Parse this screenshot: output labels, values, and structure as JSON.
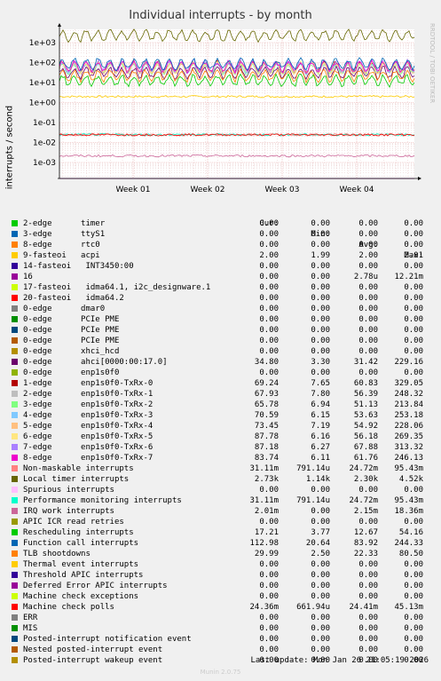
{
  "chart_data": {
    "type": "line",
    "title": "Individual interrupts - by month",
    "ylabel": "interrupts / second",
    "y_scale": "log",
    "ylim": [
      0.0001,
      3000
    ],
    "y_ticks": [
      "1e+03",
      "1e+02",
      "1e+01",
      "1e+00",
      "1e-01",
      "1e-02",
      "1e-03"
    ],
    "x_ticks": [
      "Week 01",
      "Week 02",
      "Week 03",
      "Week 04"
    ],
    "grid": true,
    "watermark": "RRDTOOL / TOBI OETIKER",
    "columns": [
      "Cur:",
      "Min:",
      "Avg:",
      "Max:"
    ],
    "series": [
      {
        "name": "2-edge      timer",
        "color": "#00cc00",
        "cur": "0.00",
        "min": "0.00",
        "avg": "0.00",
        "max": "0.00"
      },
      {
        "name": "3-edge      ttyS1",
        "color": "#0066b3",
        "cur": "0.00",
        "min": "0.00",
        "avg": "0.00",
        "max": "0.00"
      },
      {
        "name": "8-edge      rtc0",
        "color": "#ff8000",
        "cur": "0.00",
        "min": "0.00",
        "avg": "0.00",
        "max": "0.00"
      },
      {
        "name": "9-fasteoi   acpi",
        "color": "#ffcc00",
        "cur": "2.00",
        "min": "1.99",
        "avg": "2.00",
        "max": "2.01"
      },
      {
        "name": "14-fasteoi   INT3450:00",
        "color": "#330099",
        "cur": "0.00",
        "min": "0.00",
        "avg": "0.00",
        "max": "0.00"
      },
      {
        "name": "16",
        "color": "#990099",
        "cur": "0.00",
        "min": "0.00",
        "avg": "2.78u",
        "max": "12.21m"
      },
      {
        "name": "17-fasteoi   idma64.1, i2c_designware.1",
        "color": "#ccff00",
        "cur": "0.00",
        "min": "0.00",
        "avg": "0.00",
        "max": "0.00"
      },
      {
        "name": "20-fasteoi   idma64.2",
        "color": "#ff0000",
        "cur": "0.00",
        "min": "0.00",
        "avg": "0.00",
        "max": "0.00"
      },
      {
        "name": "0-edge      dmar0",
        "color": "#808080",
        "cur": "0.00",
        "min": "0.00",
        "avg": "0.00",
        "max": "0.00"
      },
      {
        "name": "0-edge      PCIe PME",
        "color": "#008f00",
        "cur": "0.00",
        "min": "0.00",
        "avg": "0.00",
        "max": "0.00"
      },
      {
        "name": "0-edge      PCIe PME",
        "color": "#00487d",
        "cur": "0.00",
        "min": "0.00",
        "avg": "0.00",
        "max": "0.00"
      },
      {
        "name": "0-edge      PCIe PME",
        "color": "#b35a00",
        "cur": "0.00",
        "min": "0.00",
        "avg": "0.00",
        "max": "0.00"
      },
      {
        "name": "0-edge      xhci_hcd",
        "color": "#b38f00",
        "cur": "0.00",
        "min": "0.00",
        "avg": "0.00",
        "max": "0.00"
      },
      {
        "name": "0-edge      ahci[0000:00:17.0]",
        "color": "#6b006b",
        "cur": "34.80",
        "min": "3.30",
        "avg": "31.42",
        "max": "229.16"
      },
      {
        "name": "0-edge      enp1s0f0",
        "color": "#8fb300",
        "cur": "0.00",
        "min": "0.00",
        "avg": "0.00",
        "max": "0.00"
      },
      {
        "name": "1-edge      enp1s0f0-TxRx-0",
        "color": "#b30000",
        "cur": "69.24",
        "min": "7.65",
        "avg": "60.83",
        "max": "329.05"
      },
      {
        "name": "2-edge      enp1s0f0-TxRx-1",
        "color": "#bebebe",
        "cur": "67.93",
        "min": "7.80",
        "avg": "56.39",
        "max": "248.32"
      },
      {
        "name": "3-edge      enp1s0f0-TxRx-2",
        "color": "#80ff80",
        "cur": "65.78",
        "min": "6.94",
        "avg": "51.13",
        "max": "213.84"
      },
      {
        "name": "4-edge      enp1s0f0-TxRx-3",
        "color": "#80c9ff",
        "cur": "70.59",
        "min": "6.15",
        "avg": "53.63",
        "max": "253.18"
      },
      {
        "name": "5-edge      enp1s0f0-TxRx-4",
        "color": "#ffc080",
        "cur": "73.45",
        "min": "7.19",
        "avg": "54.92",
        "max": "228.06"
      },
      {
        "name": "6-edge      enp1s0f0-TxRx-5",
        "color": "#ffe680",
        "cur": "87.78",
        "min": "6.16",
        "avg": "56.18",
        "max": "269.35"
      },
      {
        "name": "7-edge      enp1s0f0-TxRx-6",
        "color": "#aa80ff",
        "cur": "87.18",
        "min": "6.27",
        "avg": "67.88",
        "max": "313.32"
      },
      {
        "name": "8-edge      enp1s0f0-TxRx-7",
        "color": "#ee00cc",
        "cur": "83.74",
        "min": "6.11",
        "avg": "61.76",
        "max": "246.13"
      },
      {
        "name": "Non-maskable interrupts",
        "color": "#ff8080",
        "cur": "31.11m",
        "min": "791.14u",
        "avg": "24.72m",
        "max": "95.43m"
      },
      {
        "name": "Local timer interrupts",
        "color": "#666600",
        "cur": "2.73k",
        "min": "1.14k",
        "avg": "2.30k",
        "max": "4.52k"
      },
      {
        "name": "Spurious interrupts",
        "color": "#ffbfff",
        "cur": "0.00",
        "min": "0.00",
        "avg": "0.00",
        "max": "0.00"
      },
      {
        "name": "Performance monitoring interrupts",
        "color": "#00ffcc",
        "cur": "31.11m",
        "min": "791.14u",
        "avg": "24.72m",
        "max": "95.43m"
      },
      {
        "name": "IRQ work interrupts",
        "color": "#cc6699",
        "cur": "2.01m",
        "min": "0.00",
        "avg": "2.15m",
        "max": "18.36m"
      },
      {
        "name": "APIC ICR read retries",
        "color": "#999900",
        "cur": "0.00",
        "min": "0.00",
        "avg": "0.00",
        "max": "0.00"
      },
      {
        "name": "Rescheduling interrupts",
        "color": "#00cc00",
        "cur": "17.21",
        "min": "3.77",
        "avg": "12.67",
        "max": "54.16"
      },
      {
        "name": "Function call interrupts",
        "color": "#0066b3",
        "cur": "112.98",
        "min": "20.64",
        "avg": "83.92",
        "max": "244.33"
      },
      {
        "name": "TLB shootdowns",
        "color": "#ff8000",
        "cur": "29.99",
        "min": "2.50",
        "avg": "22.33",
        "max": "80.50"
      },
      {
        "name": "Thermal event interrupts",
        "color": "#ffcc00",
        "cur": "0.00",
        "min": "0.00",
        "avg": "0.00",
        "max": "0.00"
      },
      {
        "name": "Threshold APIC interrupts",
        "color": "#330099",
        "cur": "0.00",
        "min": "0.00",
        "avg": "0.00",
        "max": "0.00"
      },
      {
        "name": "Deferred Error APIC interrupts",
        "color": "#990099",
        "cur": "0.00",
        "min": "0.00",
        "avg": "0.00",
        "max": "0.00"
      },
      {
        "name": "Machine check exceptions",
        "color": "#ccff00",
        "cur": "0.00",
        "min": "0.00",
        "avg": "0.00",
        "max": "0.00"
      },
      {
        "name": "Machine check polls",
        "color": "#ff0000",
        "cur": "24.36m",
        "min": "661.94u",
        "avg": "24.41m",
        "max": "45.13m"
      },
      {
        "name": "ERR",
        "color": "#808080",
        "cur": "0.00",
        "min": "0.00",
        "avg": "0.00",
        "max": "0.00"
      },
      {
        "name": "MIS",
        "color": "#008f00",
        "cur": "0.00",
        "min": "0.00",
        "avg": "0.00",
        "max": "0.00"
      },
      {
        "name": "Posted-interrupt notification event",
        "color": "#00487d",
        "cur": "0.00",
        "min": "0.00",
        "avg": "0.00",
        "max": "0.00"
      },
      {
        "name": "Nested posted-interrupt event",
        "color": "#b35a00",
        "cur": "0.00",
        "min": "0.00",
        "avg": "0.00",
        "max": "0.00"
      },
      {
        "name": "Posted-interrupt wakeup event",
        "color": "#b38f00",
        "cur": "0.00",
        "min": "0.00",
        "avg": "0.00",
        "max": "0.00"
      }
    ]
  },
  "footer": {
    "last_update": "Last update: Mon Jan 26 21:05:19 2026",
    "munin": "Munin 2.0.75"
  }
}
